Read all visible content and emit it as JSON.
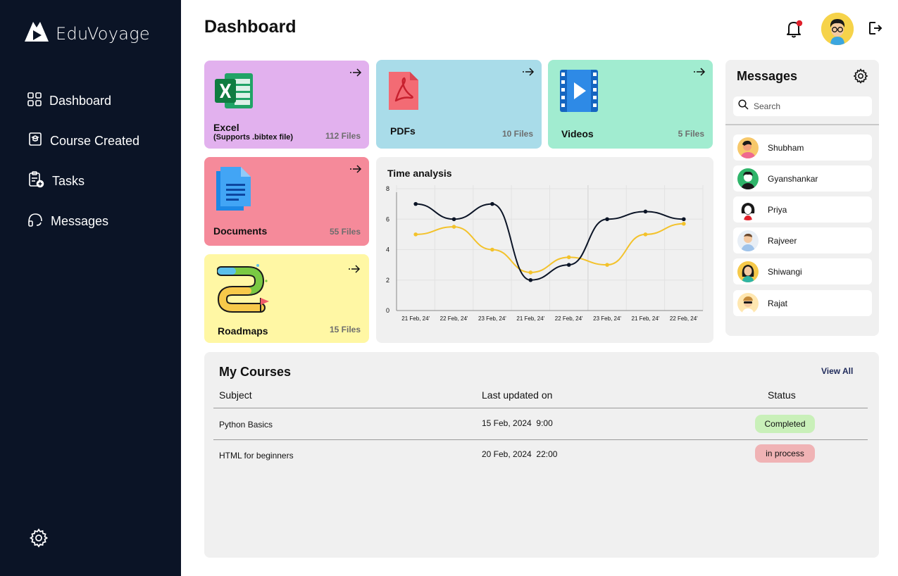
{
  "app": {
    "name": "EduVoyage"
  },
  "sidebar": {
    "items": [
      {
        "label": "Dashboard",
        "icon": "grid-icon"
      },
      {
        "label": "Course Created",
        "icon": "course-icon"
      },
      {
        "label": "Tasks",
        "icon": "tasks-icon"
      },
      {
        "label": "Messages",
        "icon": "headset-icon"
      }
    ],
    "settings_icon": "gear-icon"
  },
  "header": {
    "title": "Dashboard",
    "bell_icon": "bell-icon",
    "notification_color": "#e0202a",
    "logout_icon": "logout-icon"
  },
  "tiles": [
    {
      "label": "Excel",
      "sublabel": "(Supports .bibtex file)",
      "count": "112 Files",
      "color": "#e2b1ee",
      "icon": "excel-icon"
    },
    {
      "label": "PDFs",
      "count": "10 Files",
      "color": "#a9dce9",
      "icon": "pdf-icon"
    },
    {
      "label": "Videos",
      "count": "5 Files",
      "color": "#a1ecd0",
      "icon": "video-icon"
    },
    {
      "label": "Documents",
      "count": "55 Files",
      "color": "#f58a9a",
      "icon": "document-icon"
    },
    {
      "label": "Roadmaps",
      "count": "15 Files",
      "color": "#fff7a4",
      "icon": "roadmap-icon"
    }
  ],
  "chart": {
    "title": "Time analysis",
    "chart_data": {
      "type": "line",
      "categories": [
        "21 Feb, 24'",
        "22 Feb, 24'",
        "23 Feb, 24'",
        "21 Feb, 24'",
        "22 Feb, 24'",
        "23 Feb, 24'",
        "21 Feb, 24'",
        "22 Feb, 24'"
      ],
      "series": [
        {
          "values": [
            7,
            6,
            7,
            2,
            3,
            6,
            6.5,
            6
          ],
          "color": "#0b1426"
        },
        {
          "values": [
            5,
            5.5,
            4,
            2.5,
            3.5,
            3,
            5,
            5.7
          ],
          "color": "#f3c22b"
        }
      ],
      "yticks": [
        0,
        2,
        4,
        6,
        8
      ],
      "ylim": [
        0,
        8
      ],
      "grid": true
    }
  },
  "messages": {
    "title": "Messages",
    "search_placeholder": "Search",
    "contacts": [
      {
        "name": "Shubham",
        "avatar_color": "#f7c86a"
      },
      {
        "name": "Gyanshankar",
        "avatar_color": "#2fb56a"
      },
      {
        "name": "Priya",
        "avatar_color": "#ffffff"
      },
      {
        "name": "Rajveer",
        "avatar_color": "#9fc3ea"
      },
      {
        "name": "Shiwangi",
        "avatar_color": "#f6c94a"
      },
      {
        "name": "Rajat",
        "avatar_color": "#ffe7b0"
      }
    ]
  },
  "courses": {
    "title": "My Courses",
    "view_all": "View All",
    "columns": [
      "Subject",
      "Last updated on",
      "Status"
    ],
    "rows": [
      {
        "subject": "Python Basics",
        "updated": "15 Feb, 2024  9:00",
        "status": "Completed",
        "status_color": "#c9f0b9"
      },
      {
        "subject": "HTML for beginners",
        "updated": "20 Feb, 2024  22:00",
        "status": "in process",
        "status_color": "#f0b3b5"
      }
    ]
  }
}
